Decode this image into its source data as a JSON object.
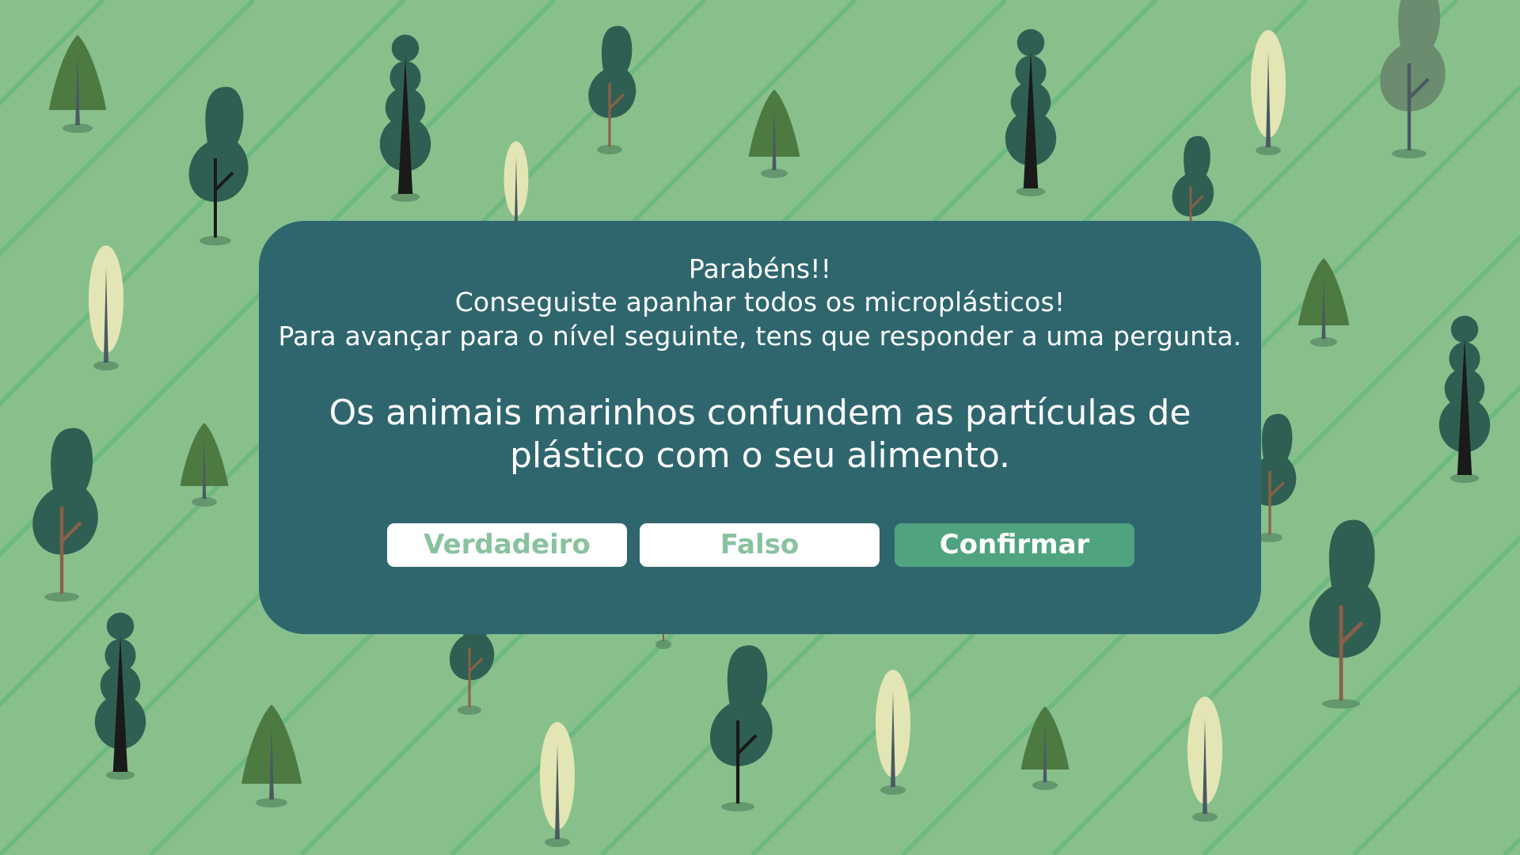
{
  "game": {
    "background_color": "#88c08c",
    "stripe_color": "#6eb980",
    "tree_colors": {
      "dark_green": "#2f5f52",
      "olive": "#4d7a40",
      "pale": "#e3e6b4",
      "grey_green": "#6b8c6e",
      "trunk_dark": "#1a1a1a",
      "trunk_slate": "#4a5a63",
      "trunk_brown": "#8c5f48"
    }
  },
  "dialog": {
    "background_color": "#2f666e",
    "line1": "Parabéns!!",
    "line2": "Conseguiste apanhar todos os microplásticos!",
    "line3": "Para avançar para o nível seguinte, tens que responder a uma pergunta.",
    "question_line1": "Os animais marinhos confundem as partículas de",
    "question_line2": "plástico com o seu alimento.",
    "buttons": {
      "true_label": "Verdadeiro",
      "false_label": "Falso",
      "confirm_label": "Confirmar",
      "confirm_color": "#4fa37f",
      "option_text_color": "#88c29e"
    }
  }
}
